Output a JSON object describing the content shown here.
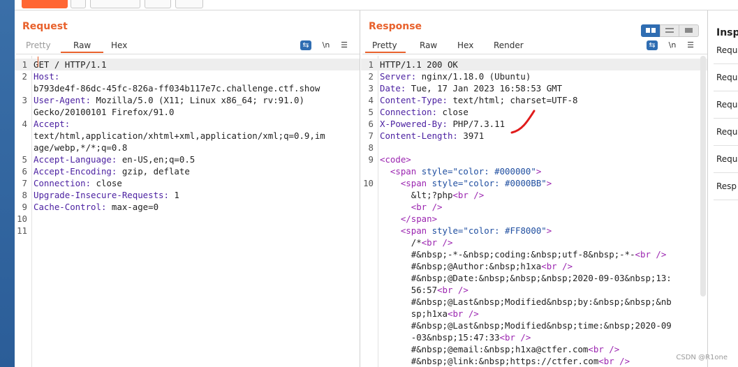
{
  "request": {
    "title": "Request",
    "tabs": [
      "Pretty",
      "Raw",
      "Hex"
    ],
    "active_tab": "Raw",
    "lines": [
      {
        "n": "1",
        "parts": [
          {
            "t": "GET / HTTP/1.1",
            "c": ""
          }
        ]
      },
      {
        "n": "2",
        "parts": [
          {
            "t": "Host:",
            "c": "hk"
          }
        ]
      },
      {
        "n": "",
        "parts": [
          {
            "t": "b793de4f-86dc-45fc-826a-ff034b117e7c.challenge.ctf.show",
            "c": ""
          }
        ]
      },
      {
        "n": "3",
        "parts": [
          {
            "t": "User-Agent:",
            "c": "hk"
          },
          {
            "t": " Mozilla/5.0 (X11; Linux x86_64; rv:91.0)",
            "c": ""
          }
        ]
      },
      {
        "n": "",
        "parts": [
          {
            "t": "Gecko/20100101 Firefox/91.0",
            "c": ""
          }
        ]
      },
      {
        "n": "4",
        "parts": [
          {
            "t": "Accept:",
            "c": "hk"
          }
        ]
      },
      {
        "n": "",
        "parts": [
          {
            "t": "text/html,application/xhtml+xml,application/xml;q=0.9,im",
            "c": ""
          }
        ]
      },
      {
        "n": "",
        "parts": [
          {
            "t": "age/webp,*/*;q=0.8",
            "c": ""
          }
        ]
      },
      {
        "n": "5",
        "parts": [
          {
            "t": "Accept-Language:",
            "c": "hk"
          },
          {
            "t": " en-US,en;q=0.5",
            "c": ""
          }
        ]
      },
      {
        "n": "6",
        "parts": [
          {
            "t": "Accept-Encoding:",
            "c": "hk"
          },
          {
            "t": " gzip, deflate",
            "c": ""
          }
        ]
      },
      {
        "n": "7",
        "parts": [
          {
            "t": "Connection:",
            "c": "hk"
          },
          {
            "t": " close",
            "c": ""
          }
        ]
      },
      {
        "n": "8",
        "parts": [
          {
            "t": "Upgrade-Insecure-Requests:",
            "c": "hk"
          },
          {
            "t": " 1",
            "c": ""
          }
        ]
      },
      {
        "n": "9",
        "parts": [
          {
            "t": "Cache-Control:",
            "c": "hk"
          },
          {
            "t": " max-age=0",
            "c": ""
          }
        ]
      },
      {
        "n": "10",
        "parts": []
      },
      {
        "n": "11",
        "parts": []
      }
    ]
  },
  "response": {
    "title": "Response",
    "tabs": [
      "Pretty",
      "Raw",
      "Hex",
      "Render"
    ],
    "active_tab": "Pretty",
    "lines": [
      {
        "n": "1",
        "parts": [
          {
            "t": "HTTP/1.1 200 OK",
            "c": ""
          }
        ]
      },
      {
        "n": "2",
        "parts": [
          {
            "t": "Server:",
            "c": "hk"
          },
          {
            "t": " nginx/1.18.0 (Ubuntu)",
            "c": ""
          }
        ]
      },
      {
        "n": "3",
        "parts": [
          {
            "t": "Date:",
            "c": "hk"
          },
          {
            "t": " Tue, 17 Jan 2023 16:58:53 GMT",
            "c": ""
          }
        ]
      },
      {
        "n": "4",
        "parts": [
          {
            "t": "Content-Type:",
            "c": "hk"
          },
          {
            "t": " text/html; charset=UTF-8",
            "c": ""
          }
        ]
      },
      {
        "n": "5",
        "parts": [
          {
            "t": "Connection:",
            "c": "hk"
          },
          {
            "t": " close",
            "c": ""
          }
        ]
      },
      {
        "n": "6",
        "parts": [
          {
            "t": "X-Powered-By:",
            "c": "hk"
          },
          {
            "t": " PHP/7.3.11",
            "c": ""
          }
        ]
      },
      {
        "n": "7",
        "parts": [
          {
            "t": "Content-Length:",
            "c": "hk"
          },
          {
            "t": " 3971",
            "c": ""
          }
        ]
      },
      {
        "n": "8",
        "parts": []
      },
      {
        "n": "9",
        "parts": [
          {
            "t": "<code>",
            "c": "tg"
          }
        ]
      },
      {
        "n": "",
        "parts": [
          {
            "t": "  <span ",
            "c": "tg"
          },
          {
            "t": "style",
            "c": "at"
          },
          {
            "t": "=\"color: #000000\"",
            "c": "st"
          },
          {
            "t": ">",
            "c": "tg"
          }
        ]
      },
      {
        "n": "10",
        "parts": [
          {
            "t": "    <span ",
            "c": "tg"
          },
          {
            "t": "style",
            "c": "at"
          },
          {
            "t": "=\"color: #0000BB\"",
            "c": "st"
          },
          {
            "t": ">",
            "c": "tg"
          }
        ]
      },
      {
        "n": "",
        "parts": [
          {
            "t": "      &lt;?php",
            "c": ""
          },
          {
            "t": "<br />",
            "c": "tg"
          }
        ]
      },
      {
        "n": "",
        "parts": [
          {
            "t": "      <br />",
            "c": "tg"
          }
        ]
      },
      {
        "n": "",
        "parts": [
          {
            "t": "    </span>",
            "c": "tg"
          }
        ]
      },
      {
        "n": "",
        "parts": [
          {
            "t": "    <span ",
            "c": "tg"
          },
          {
            "t": "style",
            "c": "at"
          },
          {
            "t": "=\"color: #FF8000\"",
            "c": "st"
          },
          {
            "t": ">",
            "c": "tg"
          }
        ]
      },
      {
        "n": "",
        "parts": [
          {
            "t": "      /*",
            "c": ""
          },
          {
            "t": "<br />",
            "c": "tg"
          }
        ]
      },
      {
        "n": "",
        "parts": [
          {
            "t": "      #&nbsp;-*-&nbsp;coding:&nbsp;utf-8&nbsp;-*-",
            "c": ""
          },
          {
            "t": "<br />",
            "c": "tg"
          }
        ]
      },
      {
        "n": "",
        "parts": [
          {
            "t": "      #&nbsp;@Author:&nbsp;h1xa",
            "c": ""
          },
          {
            "t": "<br />",
            "c": "tg"
          }
        ]
      },
      {
        "n": "",
        "parts": [
          {
            "t": "      #&nbsp;@Date:&nbsp;&nbsp;&nbsp;2020-09-03&nbsp;13:",
            "c": ""
          }
        ]
      },
      {
        "n": "",
        "parts": [
          {
            "t": "      56:57",
            "c": ""
          },
          {
            "t": "<br />",
            "c": "tg"
          }
        ]
      },
      {
        "n": "",
        "parts": [
          {
            "t": "      #&nbsp;@Last&nbsp;Modified&nbsp;by:&nbsp;&nbsp;&nb",
            "c": ""
          }
        ]
      },
      {
        "n": "",
        "parts": [
          {
            "t": "      sp;h1xa",
            "c": ""
          },
          {
            "t": "<br />",
            "c": "tg"
          }
        ]
      },
      {
        "n": "",
        "parts": [
          {
            "t": "      #&nbsp;@Last&nbsp;Modified&nbsp;time:&nbsp;2020-09",
            "c": ""
          }
        ]
      },
      {
        "n": "",
        "parts": [
          {
            "t": "      -03&nbsp;15:47:33",
            "c": ""
          },
          {
            "t": "<br />",
            "c": "tg"
          }
        ]
      },
      {
        "n": "",
        "parts": [
          {
            "t": "      #&nbsp;@email:&nbsp;h1xa@ctfer.com",
            "c": ""
          },
          {
            "t": "<br />",
            "c": "tg"
          }
        ]
      },
      {
        "n": "",
        "parts": [
          {
            "t": "      #&nbsp;@link:&nbsp;https://ctfer.com",
            "c": ""
          },
          {
            "t": "<br />",
            "c": "tg"
          }
        ]
      }
    ]
  },
  "tool_icons": {
    "wrap": "wrap-lines-icon",
    "newline": "\\n",
    "menu": "☰"
  },
  "inspector": {
    "title": "Insp",
    "items": [
      "Requ",
      "Requ",
      "Requ",
      "Requ",
      "Requ",
      "Resp"
    ]
  },
  "watermark": "CSDN @R1one",
  "colors": {
    "accent": "#e8612c",
    "key": "#4a1fa0",
    "tag": "#9b25b0",
    "attr": "#1f4ea0",
    "toggle": "#2f6db2",
    "annotation": "#e01b1b"
  }
}
